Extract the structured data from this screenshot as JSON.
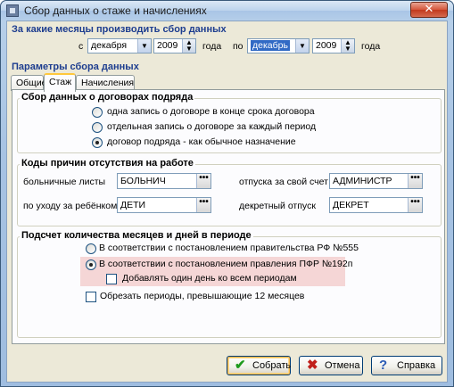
{
  "window": {
    "title": "Сбор данных о стаже и начислениях",
    "close_label": "✕"
  },
  "period": {
    "heading": "За какие месяцы производить сбор данных",
    "from_label": "с",
    "from_month": "декабря",
    "from_year": "2009",
    "year_word_1": "года",
    "to_label": "по",
    "to_month": "декабрь",
    "to_year": "2009",
    "year_word_2": "года"
  },
  "params_heading": "Параметры сбора данных",
  "tabs": [
    {
      "label": "Общие"
    },
    {
      "label": "Стаж"
    },
    {
      "label": "Начисления"
    }
  ],
  "contracts": {
    "title": "Сбор данных о договорах подряда",
    "options": [
      {
        "label": "одна запись о договоре в конце срока договора",
        "checked": false
      },
      {
        "label": "отдельная запись о договоре за каждый период",
        "checked": false
      },
      {
        "label": "договор подряда - как обычное назначение",
        "checked": true
      }
    ]
  },
  "absence": {
    "title": "Коды причин отсутствия на работе",
    "sick_label": "больничные листы",
    "sick_value": "БОЛЬНИЧ",
    "own_leave_label": "отпуска за свой счет",
    "own_leave_value": "АДМИНИСТР",
    "childcare_label": "по уходу за ребёнком",
    "childcare_value": "ДЕТИ",
    "maternity_label": "декретный отпуск",
    "maternity_value": "ДЕКРЕТ",
    "dots": "•••"
  },
  "count": {
    "title": "Подсчет количества месяцев и дней в периоде",
    "option_555": "В соответствии с постановлением правительства РФ №555",
    "option_192": "В соответствии с постановлением правления ПФР №192п",
    "add_day": "Добавлять один день ко всем периодам",
    "trim": "Обрезать периоды, превышающие 12 месяцев",
    "selected": "option_192"
  },
  "buttons": {
    "save": "Собрать",
    "cancel": "Отмена",
    "help": "Справка"
  },
  "colors": {
    "accent": "#1d3d8f",
    "highlight": "#f5d6d6",
    "selection": "#316ac5"
  }
}
